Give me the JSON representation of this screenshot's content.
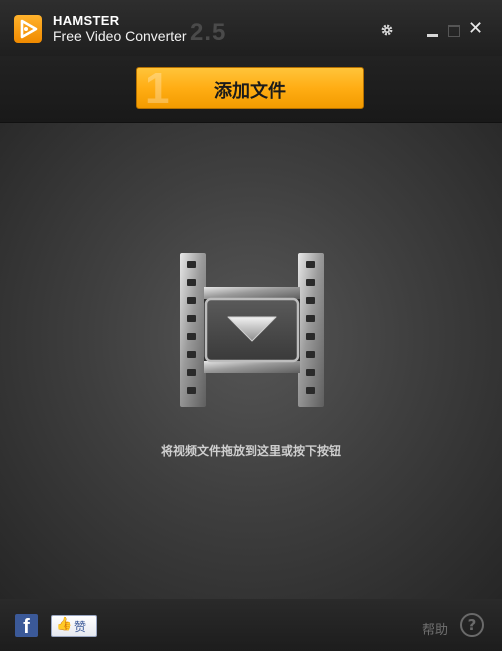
{
  "app": {
    "brand_name": "HAMSTER",
    "product_name": "Free Video Converter",
    "version": "2.5"
  },
  "titlebar": {
    "settings_icon": "gear-icon",
    "minimize_icon": "minimize-icon",
    "maximize_icon": "maximize-icon",
    "close_icon": "close-icon",
    "close_glyph": "✕"
  },
  "toolbar": {
    "step_number": "1",
    "add_file_label": "添加文件"
  },
  "drop_area": {
    "icon": "filmstrip-icon",
    "hint": "将视频文件拖放到这里或按下按钮"
  },
  "footer": {
    "facebook_glyph": "f",
    "like_label": "赞",
    "help_label": "帮助",
    "help_glyph": "?"
  },
  "colors": {
    "accent": "#ffad14",
    "facebook": "#3b5998",
    "background": "#262626"
  }
}
